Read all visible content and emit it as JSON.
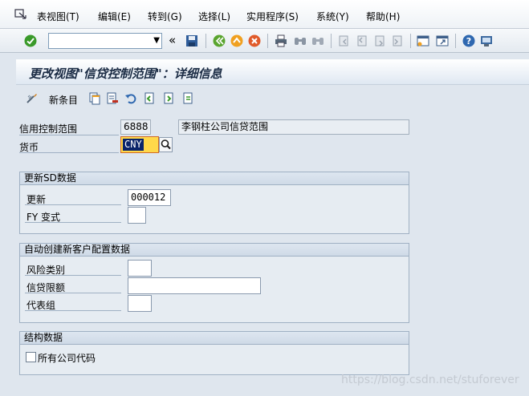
{
  "menu": [
    "表视图(T)",
    "编辑(E)",
    "转到(G)",
    "选择(L)",
    "实用程序(S)",
    "系统(Y)",
    "帮助(H)"
  ],
  "toolbar": {
    "command_value": "",
    "expand_glyph": "«"
  },
  "title": "更改视图\"信贷控制范围\"：详细信息",
  "app_toolbar": {
    "new_entries": "新条目"
  },
  "fields": {
    "credit_area_label": "信用控制范围",
    "credit_area_value": "6888",
    "credit_area_desc": "李钢柱公司信贷范围",
    "currency_label": "货币",
    "currency_value": "CNY"
  },
  "groups": {
    "sd": {
      "title": "更新SD数据",
      "update_label": "更新",
      "update_value": "000012",
      "fy_label": "FY 变式",
      "fy_value": ""
    },
    "auto": {
      "title": "自动创建新客户配置数据",
      "risk_label": "风险类别",
      "limit_label": "信贷限额",
      "rep_label": "代表组"
    },
    "struct": {
      "title": "结构数据",
      "all_codes_label": "所有公司代码"
    }
  },
  "watermark": "https://blog.csdn.net/stuforever",
  "colors": {
    "background": "#dfe6ee",
    "accent": "#0a246a",
    "ok_green": "#3a9a2a"
  }
}
